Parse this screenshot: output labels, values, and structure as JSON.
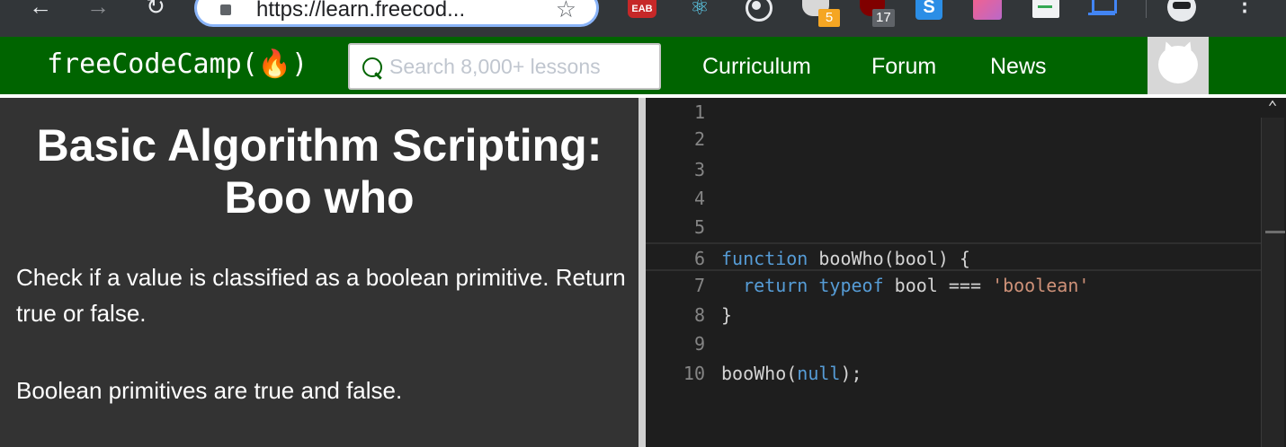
{
  "browser": {
    "url": "https://learn.freecod...",
    "extensions": [
      {
        "name": "eab-icon",
        "label": "EAB"
      },
      {
        "name": "react-devtools-icon"
      },
      {
        "name": "target-icon"
      },
      {
        "name": "raccoon-icon",
        "badge": "5"
      },
      {
        "name": "ublock-icon",
        "badge": "17"
      },
      {
        "name": "s-extension-icon",
        "label": "S"
      },
      {
        "name": "gradient-extension-icon"
      },
      {
        "name": "doc-extension-icon"
      },
      {
        "name": "frame-extension-icon"
      }
    ],
    "colors": {
      "frame": "#323639",
      "focus_ring": "#8ab4f8"
    }
  },
  "nav": {
    "brand": "freeCodeCamp(🔥)",
    "search_placeholder": "Search 8,000+ lessons",
    "links": [
      "Curriculum",
      "Forum",
      "News"
    ],
    "colors": {
      "bar": "#006400",
      "text": "#ffffff"
    }
  },
  "lesson": {
    "title": "Basic Algorithm Scripting: Boo who",
    "paragraphs": [
      "Check if a value is classified as a boolean primitive. Return true or false.",
      "Boolean primitives are true and false."
    ],
    "background": "#333333"
  },
  "editor": {
    "current_line": 6,
    "lines": [
      {
        "n": "1",
        "tokens": []
      },
      {
        "n": "2",
        "tokens": []
      },
      {
        "n": "3",
        "tokens": []
      },
      {
        "n": "4",
        "tokens": []
      },
      {
        "n": "5",
        "tokens": []
      },
      {
        "n": "6",
        "tokens": [
          {
            "t": "function",
            "c": "kw"
          },
          {
            "t": " booWho(bool) {",
            "c": ""
          }
        ]
      },
      {
        "n": "7",
        "tokens": [
          {
            "t": "  ",
            "c": ""
          },
          {
            "t": "return",
            "c": "kw"
          },
          {
            "t": " ",
            "c": ""
          },
          {
            "t": "typeof",
            "c": "kw"
          },
          {
            "t": " bool === ",
            "c": ""
          },
          {
            "t": "'boolean'",
            "c": "str"
          }
        ]
      },
      {
        "n": "8",
        "tokens": [
          {
            "t": "}",
            "c": ""
          }
        ]
      },
      {
        "n": "9",
        "tokens": []
      },
      {
        "n": "10",
        "tokens": [
          {
            "t": "booWho(",
            "c": ""
          },
          {
            "t": "null",
            "c": "kw"
          },
          {
            "t": ");",
            "c": ""
          }
        ]
      }
    ],
    "colors": {
      "background": "#1e1e1e",
      "keyword": "#569cd6",
      "string": "#ce9178",
      "text": "#d4d4d4",
      "line_number": "#858585"
    }
  }
}
